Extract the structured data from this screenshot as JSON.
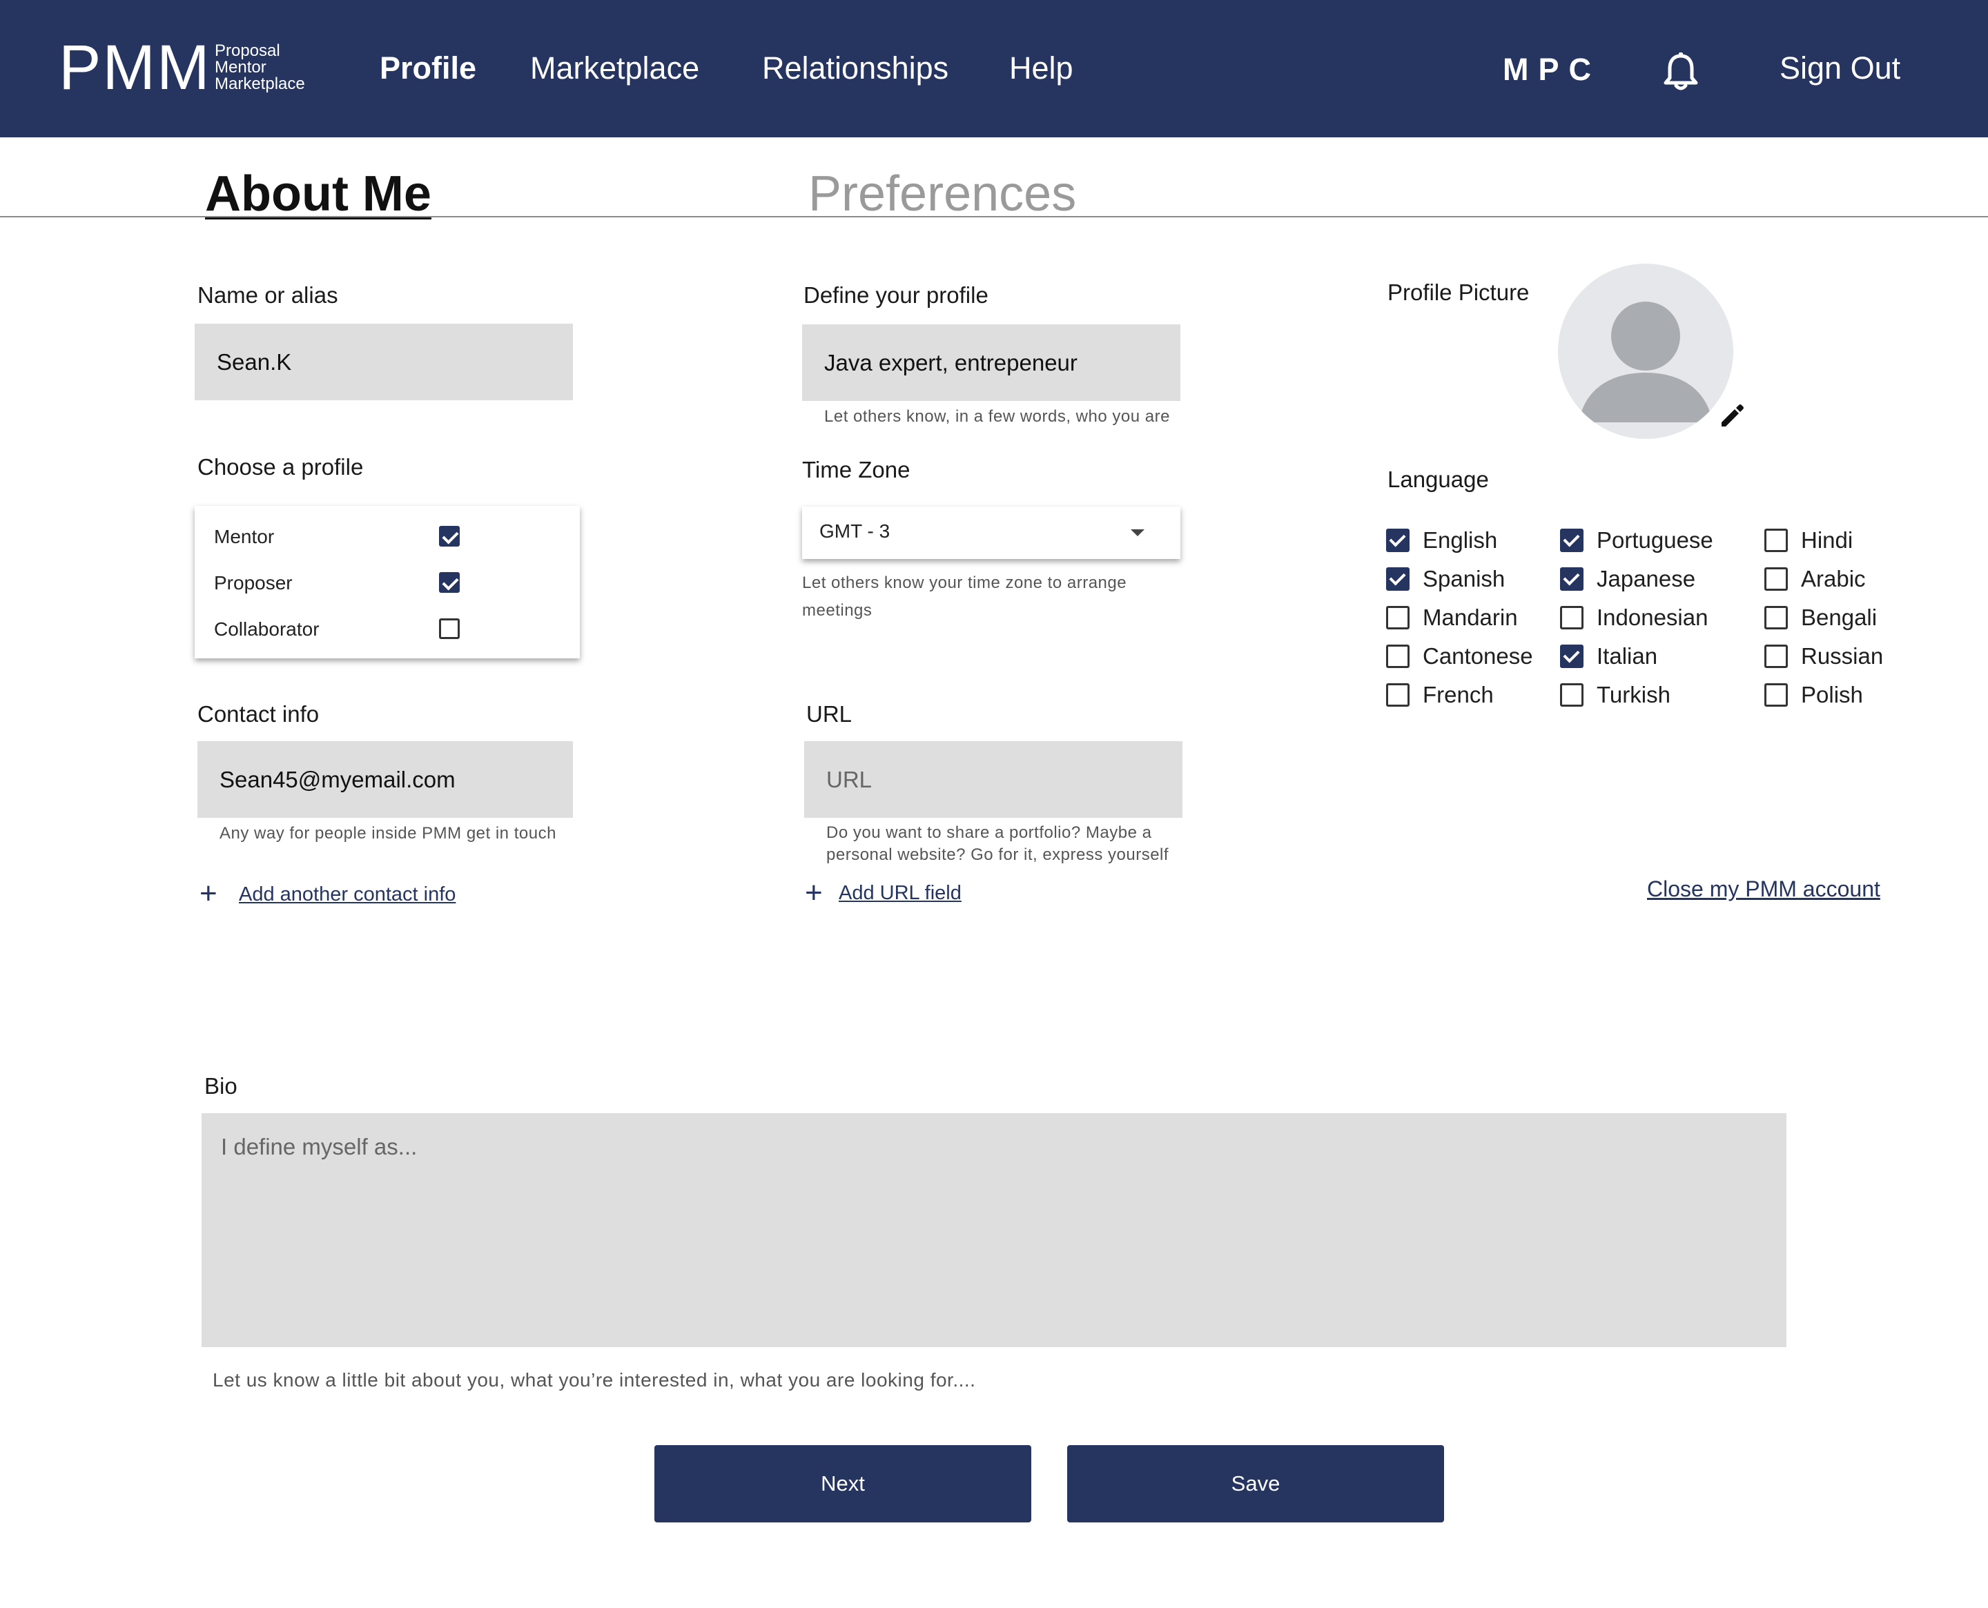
{
  "header": {
    "logo_abbr": "PMM",
    "logo_line1": "Proposal",
    "logo_line2": "Mentor",
    "logo_line3": "Marketplace",
    "nav": [
      "Profile",
      "Marketplace",
      "Relationships",
      "Help"
    ],
    "initials": "MPC",
    "sign_out": "Sign Out"
  },
  "tabs": {
    "about": "About Me",
    "preferences": "Preferences"
  },
  "name": {
    "label": "Name or alias",
    "value": "Sean.K"
  },
  "define": {
    "label": "Define your profile",
    "value": "Java expert, entrepeneur",
    "hint": "Let others know, in a few words, who you are"
  },
  "profile_picture": {
    "label": "Profile Picture"
  },
  "choose_profile": {
    "label": "Choose a profile",
    "options": [
      {
        "label": "Mentor",
        "checked": true
      },
      {
        "label": "Proposer",
        "checked": true
      },
      {
        "label": "Collaborator",
        "checked": false
      }
    ]
  },
  "timezone": {
    "label": "Time Zone",
    "value": "GMT - 3",
    "hint_line1": "Let others know your time zone to arrange",
    "hint_line2": "meetings"
  },
  "language": {
    "label": "Language",
    "items": [
      {
        "label": "English",
        "checked": true
      },
      {
        "label": "Portuguese",
        "checked": true
      },
      {
        "label": "Hindi",
        "checked": false
      },
      {
        "label": "Spanish",
        "checked": true
      },
      {
        "label": "Japanese",
        "checked": true
      },
      {
        "label": "Arabic",
        "checked": false
      },
      {
        "label": "Mandarin",
        "checked": false
      },
      {
        "label": "Indonesian",
        "checked": false
      },
      {
        "label": "Bengali",
        "checked": false
      },
      {
        "label": "Cantonese",
        "checked": false
      },
      {
        "label": "Italian",
        "checked": true
      },
      {
        "label": "Russian",
        "checked": false
      },
      {
        "label": "French",
        "checked": false
      },
      {
        "label": "Turkish",
        "checked": false
      },
      {
        "label": "Polish",
        "checked": false
      }
    ]
  },
  "contact": {
    "label": "Contact info",
    "value": "Sean45@myemail.com",
    "hint": "Any way for people inside PMM get in touch",
    "add": "Add another contact info"
  },
  "url": {
    "label": "URL",
    "placeholder": "URL",
    "hint_line1": "Do you want to share a portfolio? Maybe a",
    "hint_line2": "personal website? Go for it, express yourself",
    "add": "Add URL field"
  },
  "close_account": "Close my PMM account",
  "bio": {
    "label": "Bio",
    "placeholder": "I define myself as...",
    "hint": "Let us know a little bit about you, what you’re interested in, what you are looking for...."
  },
  "buttons": {
    "next": "Next",
    "save": "Save"
  },
  "colors": {
    "primary": "#263460",
    "field_bg": "#dedede",
    "inactive_tab": "#9a9a9a"
  }
}
